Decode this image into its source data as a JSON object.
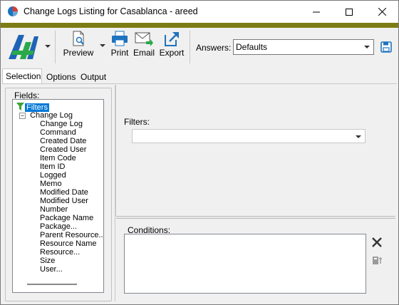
{
  "window": {
    "title": "Change Logs Listing for Casablanca - areed"
  },
  "toolbar": {
    "preview_label": "Preview",
    "print_label": "Print",
    "email_label": "Email",
    "export_label": "Export",
    "answers_label": "Answers:",
    "answers_value": "Defaults"
  },
  "tabs": [
    {
      "label": "Selection",
      "active": true
    },
    {
      "label": "Options",
      "active": false
    },
    {
      "label": "Output",
      "active": false
    }
  ],
  "fields": {
    "label": "Fields:",
    "filters_node": "Filters",
    "group_node": "Change Log",
    "items": [
      "Change Log",
      "Command",
      "Created Date",
      "Created User",
      "Item Code",
      "Item ID",
      "Logged",
      "Memo",
      "Modified Date",
      "Modified User",
      "Number",
      "Package Name",
      "Package...",
      "Parent Resource...",
      "Resource Name",
      "Resource...",
      "Size",
      "User..."
    ]
  },
  "filters": {
    "label": "Filters:",
    "value": ""
  },
  "conditions": {
    "label": "Conditions:"
  },
  "colors": {
    "accent_bar": "#7c7c14",
    "selection": "#0078d7",
    "icon_blue": "#1e73be"
  }
}
